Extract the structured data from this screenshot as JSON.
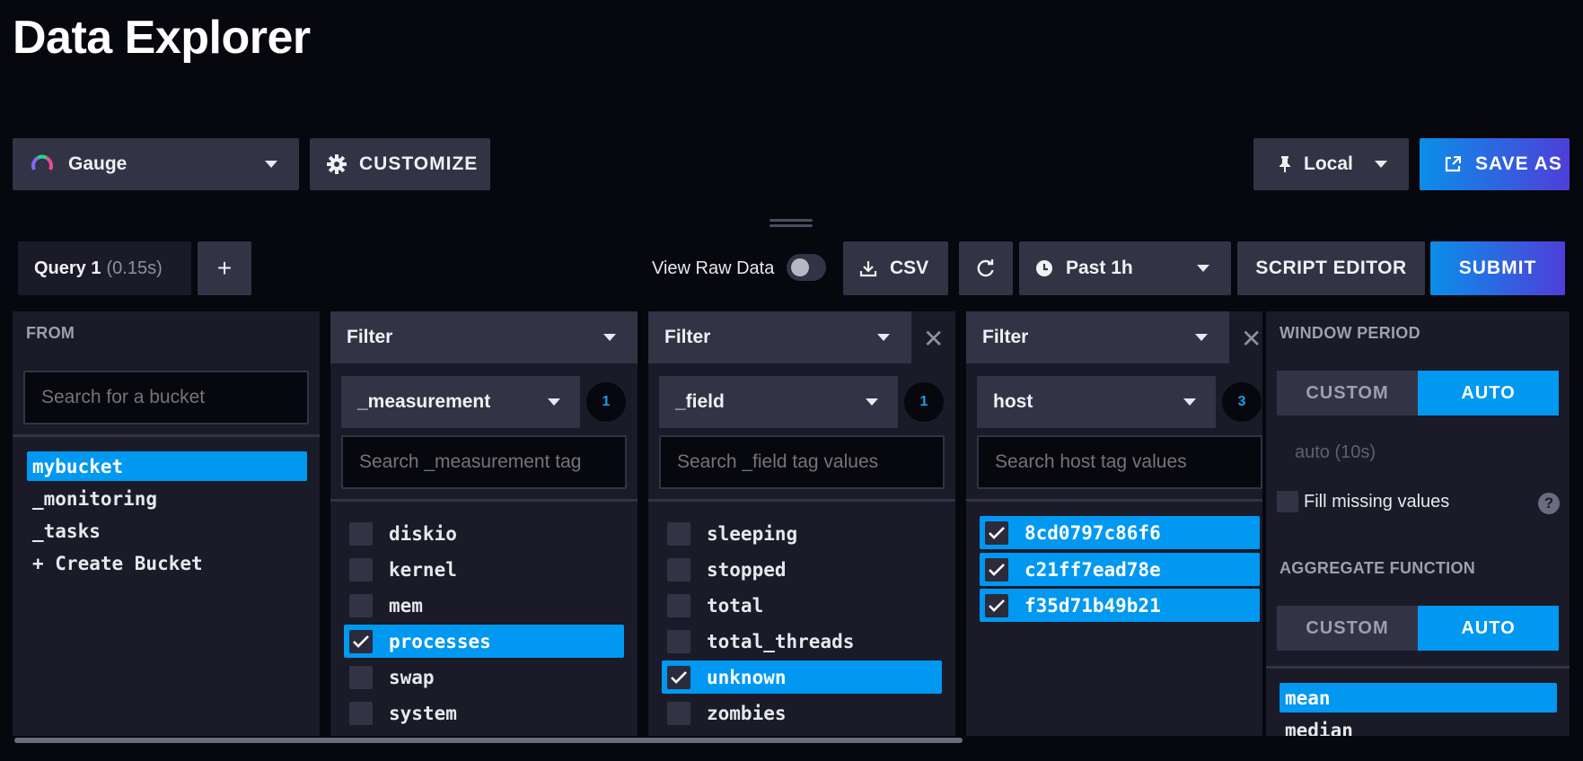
{
  "page": {
    "title": "Data Explorer"
  },
  "toolbar": {
    "viz_type": "Gauge",
    "customize_label": "CUSTOMIZE",
    "timezone": "Local",
    "save_as_label": "SAVE AS"
  },
  "query_bar": {
    "query_tab": "Query 1",
    "query_time": "(0.15s)",
    "add_label": "+",
    "view_raw_label": "View Raw Data",
    "csv_label": "CSV",
    "time_range": "Past 1h",
    "script_editor_label": "SCRIPT EDITOR",
    "submit_label": "SUBMIT"
  },
  "from": {
    "heading": "FROM",
    "search_placeholder": "Search for a bucket",
    "buckets": [
      "mybucket",
      "_monitoring",
      "_tasks",
      "+ Create Bucket"
    ],
    "selected": "mybucket"
  },
  "filters": [
    {
      "heading": "Filter",
      "key": "_measurement",
      "count": "1",
      "search_placeholder": "Search _measurement tag",
      "values": [
        "diskio",
        "kernel",
        "mem",
        "processes",
        "swap",
        "system"
      ],
      "selected": [
        "processes"
      ]
    },
    {
      "heading": "Filter",
      "key": "_field",
      "count": "1",
      "search_placeholder": "Search _field tag values",
      "values": [
        "sleeping",
        "stopped",
        "total",
        "total_threads",
        "unknown",
        "zombies"
      ],
      "selected": [
        "unknown"
      ]
    },
    {
      "heading": "Filter",
      "key": "host",
      "count": "3",
      "search_placeholder": "Search host tag values",
      "values": [
        "8cd0797c86f6",
        "c21ff7ead78e",
        "f35d71b49b21"
      ],
      "selected": [
        "8cd0797c86f6",
        "c21ff7ead78e",
        "f35d71b49b21"
      ]
    }
  ],
  "window": {
    "window_period_label": "WINDOW PERIOD",
    "custom_label": "CUSTOM",
    "auto_label": "AUTO",
    "auto_value": "auto (10s)",
    "fill_missing_label": "Fill missing values",
    "aggregate_label": "AGGREGATE FUNCTION",
    "functions": [
      "mean",
      "median"
    ],
    "selected_function": "mean"
  },
  "colors": {
    "accent": "#0098f0",
    "panel": "#1a1a29",
    "control": "#333346",
    "background": "#07070e"
  }
}
